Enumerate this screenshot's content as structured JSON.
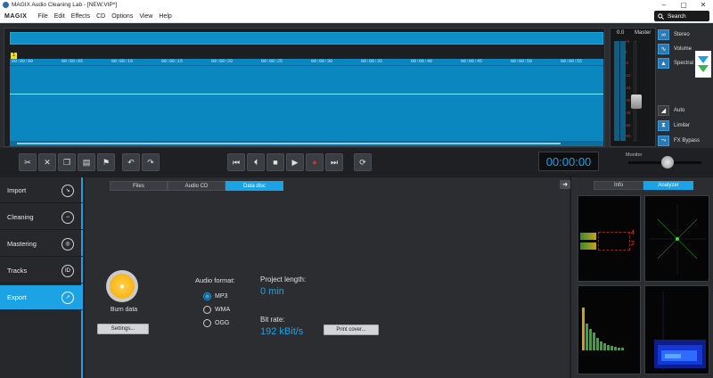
{
  "window": {
    "title": "MAGIX Audio Cleaning Lab - [NEW.VIP*]",
    "controls": [
      "–",
      "▢",
      "✕"
    ]
  },
  "menubar": {
    "brand": "MAGIX",
    "items": [
      "File",
      "Edit",
      "Effects",
      "CD",
      "Options",
      "View",
      "Help"
    ],
    "search_label": "Search"
  },
  "timeline": {
    "marker": "1",
    "ticks": [
      "00:00:00",
      "00:00:05",
      "00:00:10",
      "00:00:15",
      "00:00:20",
      "00:00:25",
      "00:00:30",
      "00:00:35",
      "00:00:40",
      "00:00:45",
      "00:00:50",
      "00:00:55"
    ]
  },
  "master": {
    "level_left": "0.0",
    "level_right": "0.0",
    "label": "Master",
    "scale": [
      "+6",
      "0",
      "-6",
      "-12",
      "-24",
      "-36",
      "-48",
      "-60",
      "-90"
    ]
  },
  "right_options": {
    "stereo": "Stereo",
    "volume": "Volume",
    "spectral": "Spectral",
    "auto": "Auto",
    "limiter": "Limiter",
    "fx_bypass": "FX Bypass"
  },
  "toolbar": {
    "time": "00:00:00",
    "monitor_label": "Monitor"
  },
  "sidebar": {
    "items": [
      {
        "label": "Import",
        "active": false
      },
      {
        "label": "Cleaning",
        "active": false
      },
      {
        "label": "Mastering",
        "active": false
      },
      {
        "label": "Tracks",
        "active": false
      },
      {
        "label": "Export",
        "active": true
      }
    ]
  },
  "export": {
    "tabs": [
      "Files",
      "Audio CD",
      "Data disc"
    ],
    "active_tab": "Data disc",
    "burn_label": "Burn data",
    "settings_label": "Settings...",
    "audio_format_label": "Audio format:",
    "formats": [
      "MP3",
      "WMA",
      "OGG"
    ],
    "selected_format": "MP3",
    "project_length_label": "Project length:",
    "project_length_value": "0 min",
    "bit_rate_label": "Bit rate:",
    "bit_rate_value": "192 kBit/s",
    "print_cover_label": "Print cover..."
  },
  "analyzer": {
    "tabs": [
      "Info",
      "Analyzer"
    ],
    "active_tab": "Analyzer",
    "peak_left": "4",
    "peak_right": "2"
  },
  "colors": {
    "accent": "#1ba3e6",
    "wave": "#0a87bf",
    "wave_line": "#e2e65e",
    "burn": "#f5a800"
  }
}
